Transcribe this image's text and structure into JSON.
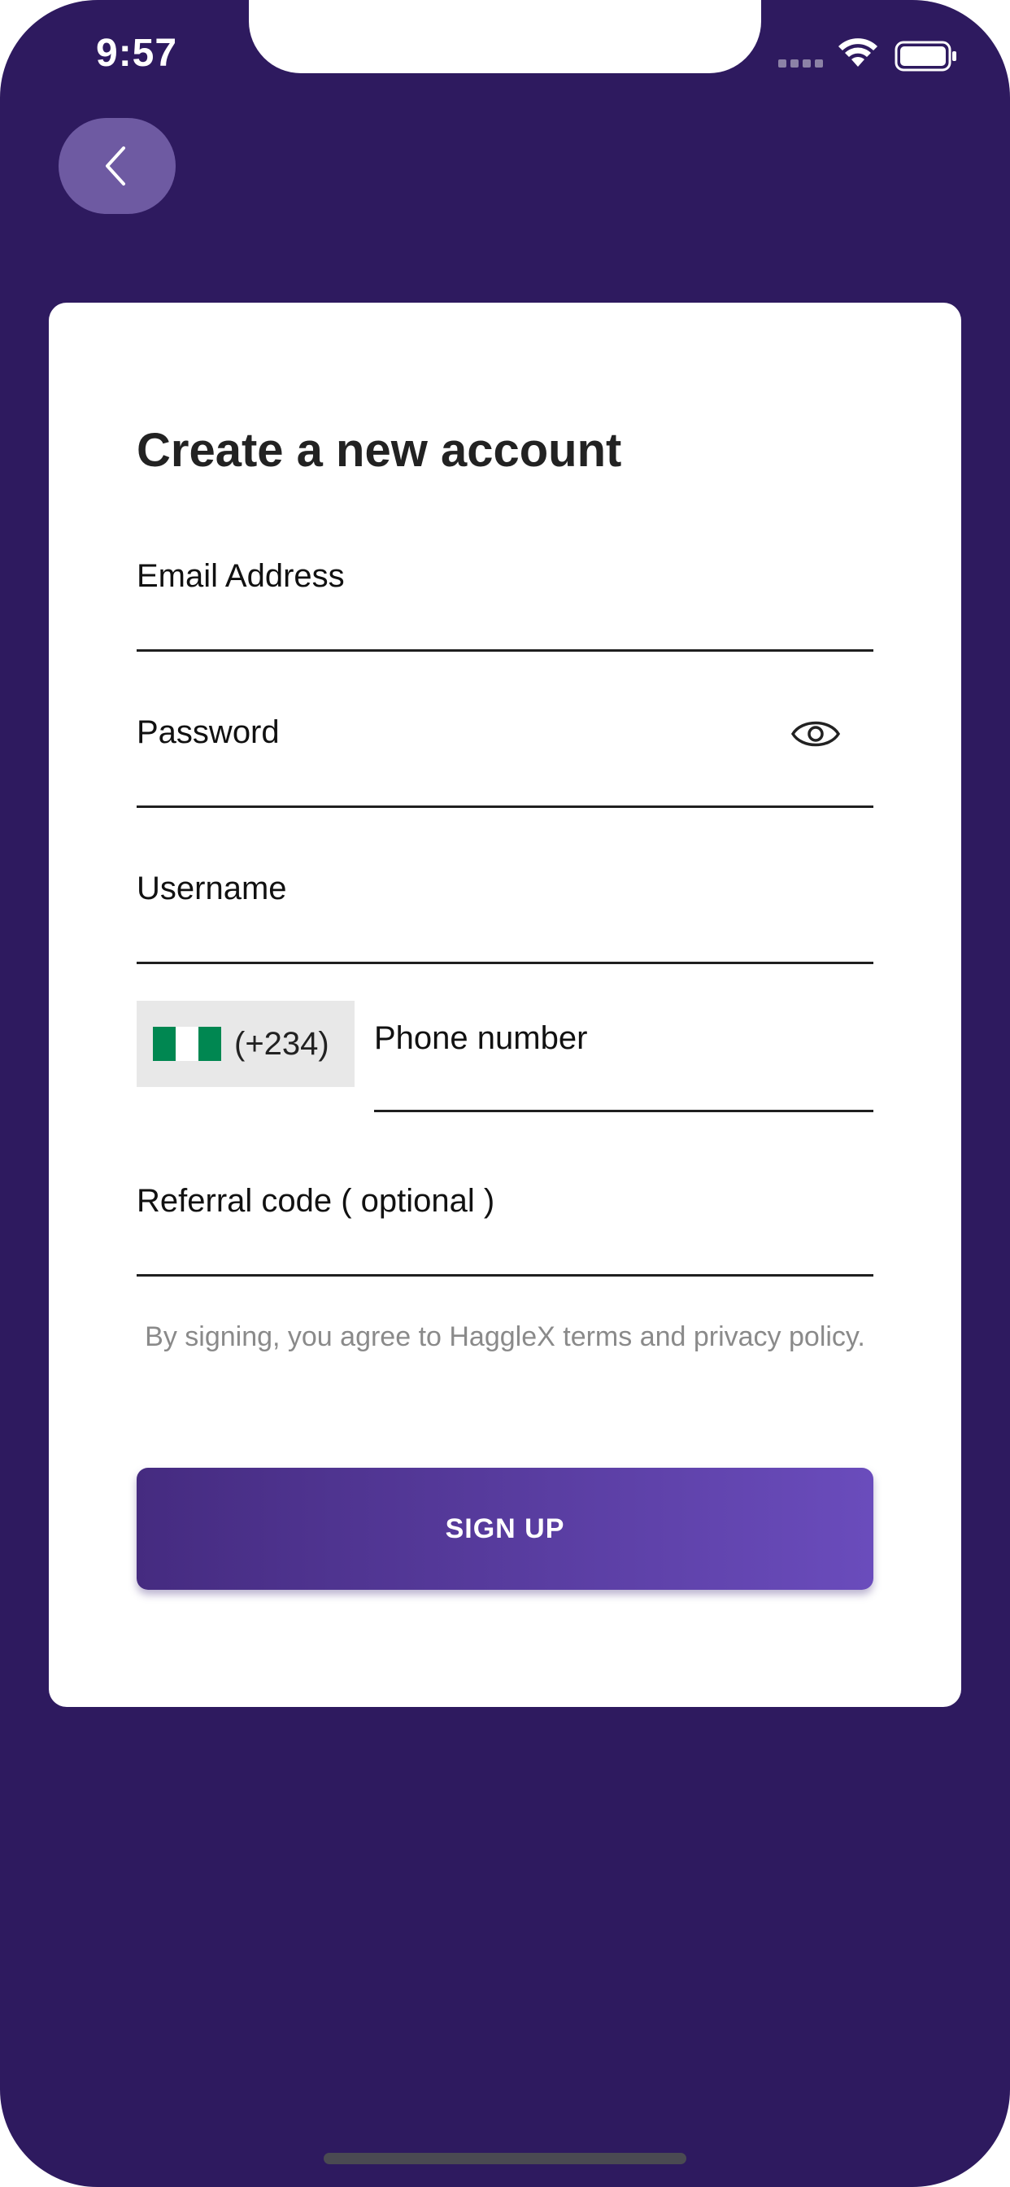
{
  "status_bar": {
    "time": "9:57"
  },
  "header": {
    "back_icon": "chevron-left-icon"
  },
  "form": {
    "title": "Create a new account",
    "email_label": "Email Address",
    "password_label": "Password",
    "password_toggle_icon": "eye-icon",
    "username_label": "Username",
    "country_flag": "nigeria-flag-icon",
    "country_code": "(+234)",
    "phone_label": "Phone number",
    "referral_label": "Referral code ( optional )",
    "terms_text": "By signing, you agree to HaggleX terms and privacy policy.",
    "signup_label": "SIGN UP"
  },
  "colors": {
    "background": "#2e1a5f",
    "back_button": "#6e5aa2",
    "button_gradient_start": "#452b80",
    "button_gradient_end": "#6a4cbc",
    "flag_green": "#008751"
  }
}
